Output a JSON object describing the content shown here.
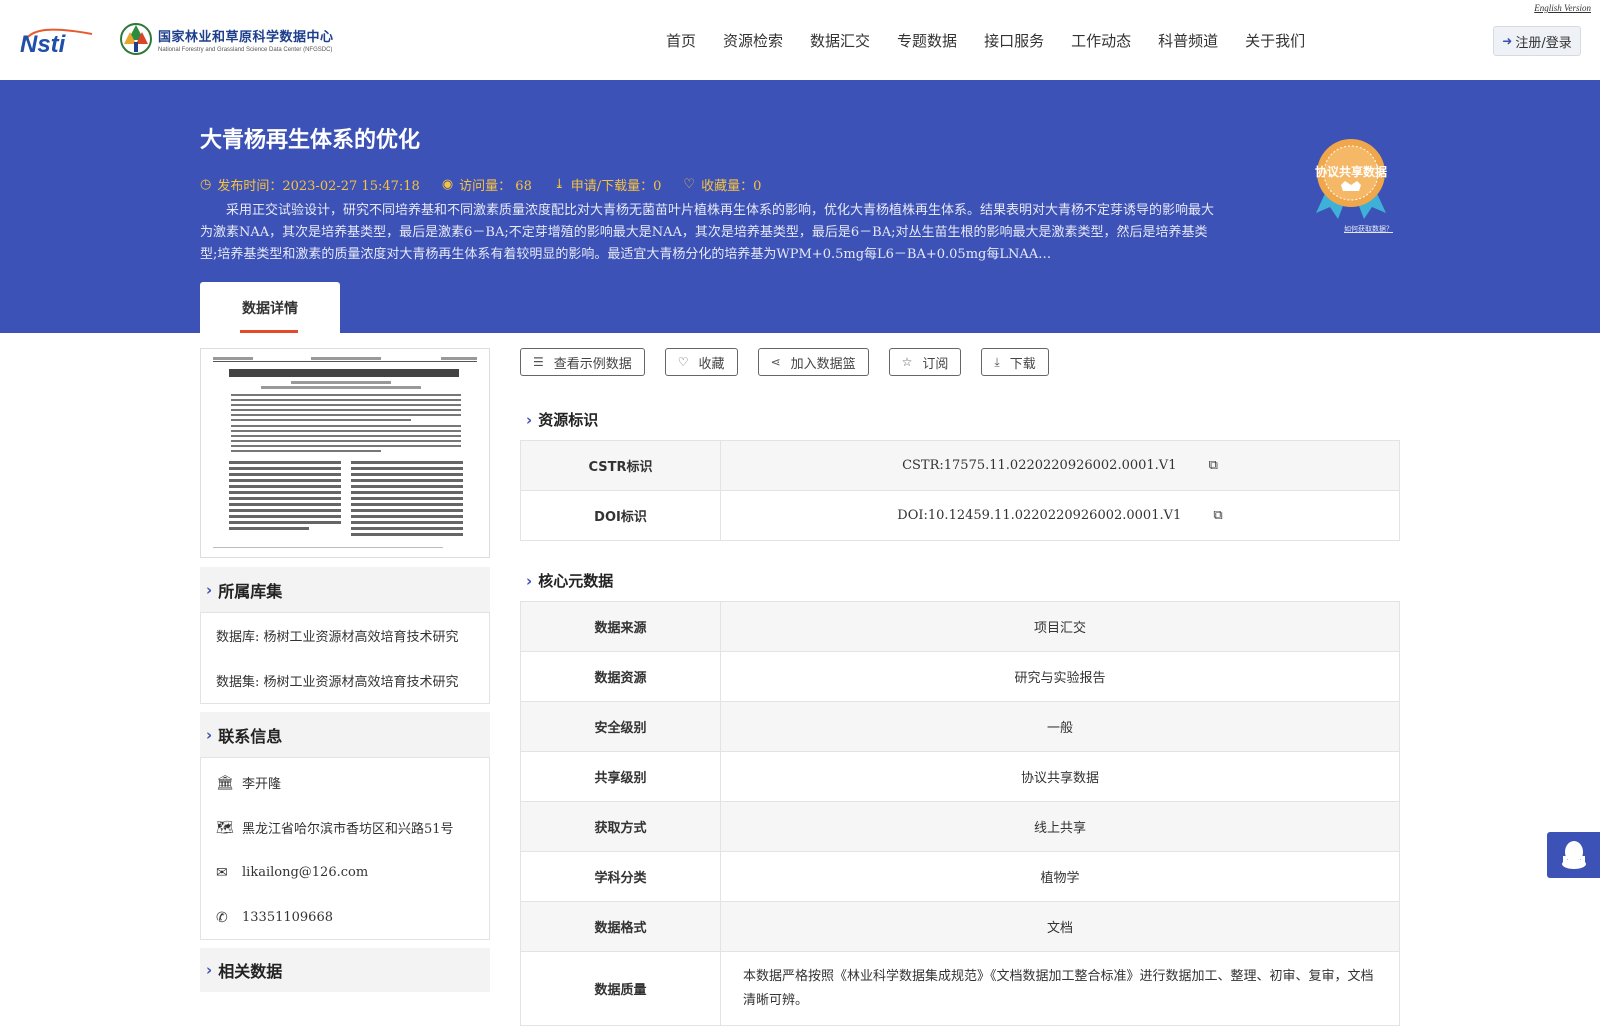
{
  "header": {
    "english_link": "English Version",
    "logo_nsti": "Nsti",
    "logo_cn": "国家林业和草原科学数据中心",
    "logo_en": "National Forestry and Grassland Science Data Center (NFGSDC)",
    "nav": [
      "首页",
      "资源检索",
      "数据汇交",
      "专题数据",
      "接口服务",
      "工作动态",
      "科普频道",
      "关于我们"
    ],
    "login_label": "注册/登录"
  },
  "banner": {
    "title": "大青杨再生体系的优化",
    "publish_time": "发布时间：2023-02-27 15:47:18",
    "visits": "访问量： 68",
    "downloads": "申请/下载量：0",
    "favorites": "收藏量：0",
    "abstract": "采用正交试验设计，研究不同培养基和不同激素质量浓度配比对大青杨无菌苗叶片植株再生体系的影响，优化大青杨植株再生体系。结果表明对大青杨不定芽诱导的影响最大为激素NAA，其次是培养基类型，最后是激素6－BA;不定芽增殖的影响最大是NAA，其次是培养基类型，最后是6－BA;对丛生苗生根的影响最大是激素类型，然后是培养基类型;培养基类型和激素的质量浓度对大青杨再生体系有着较明显的影响。最适宜大青杨分化的培养基为WPM+0.5mg每L6－BA+0.05mg每LNAA…",
    "badge_label": "协议共享数据",
    "badge_link": "如何获取数据？",
    "tab_label": "数据详情"
  },
  "sidebar": {
    "library_title": "所属库集",
    "library_items": [
      "数据库: 杨树工业资源材高效培育技术研究",
      "数据集: 杨树工业资源材高效培育技术研究"
    ],
    "contact_title": "联系信息",
    "contact": {
      "name": "李开隆",
      "address": "黑龙江省哈尔滨市香坊区和兴路51号",
      "email": "likailong@126.com",
      "phone": "13351109668"
    },
    "related_title": "相关数据"
  },
  "actions": {
    "sample": "查看示例数据",
    "favorite": "收藏",
    "basket": "加入数据篮",
    "subscribe": "订阅",
    "download": "下载"
  },
  "identifiers": {
    "title": "资源标识",
    "rows": [
      {
        "key": "CSTR标识",
        "value": "CSTR:17575.11.0220220926002.0001.V1"
      },
      {
        "key": "DOI标识",
        "value": "DOI:10.12459.11.0220220926002.0001.V1"
      }
    ]
  },
  "core_metadata": {
    "title": "核心元数据",
    "rows": [
      {
        "key": "数据来源",
        "value": "项目汇交"
      },
      {
        "key": "数据资源",
        "value": "研究与实验报告"
      },
      {
        "key": "安全级别",
        "value": "一般"
      },
      {
        "key": "共享级别",
        "value": "协议共享数据"
      },
      {
        "key": "获取方式",
        "value": "线上共享"
      },
      {
        "key": "学科分类",
        "value": "植物学"
      },
      {
        "key": "数据格式",
        "value": "文档"
      },
      {
        "key": "数据质量",
        "value": "本数据严格按照《林业科学数据集成规范》《文档数据加工整合标准》进行数据加工、整理、初审、复审，文档清晰可辨。"
      }
    ]
  },
  "colors": {
    "primary": "#3d52b6",
    "accent": "#f5c342",
    "tab_underline": "#e34b2a"
  }
}
